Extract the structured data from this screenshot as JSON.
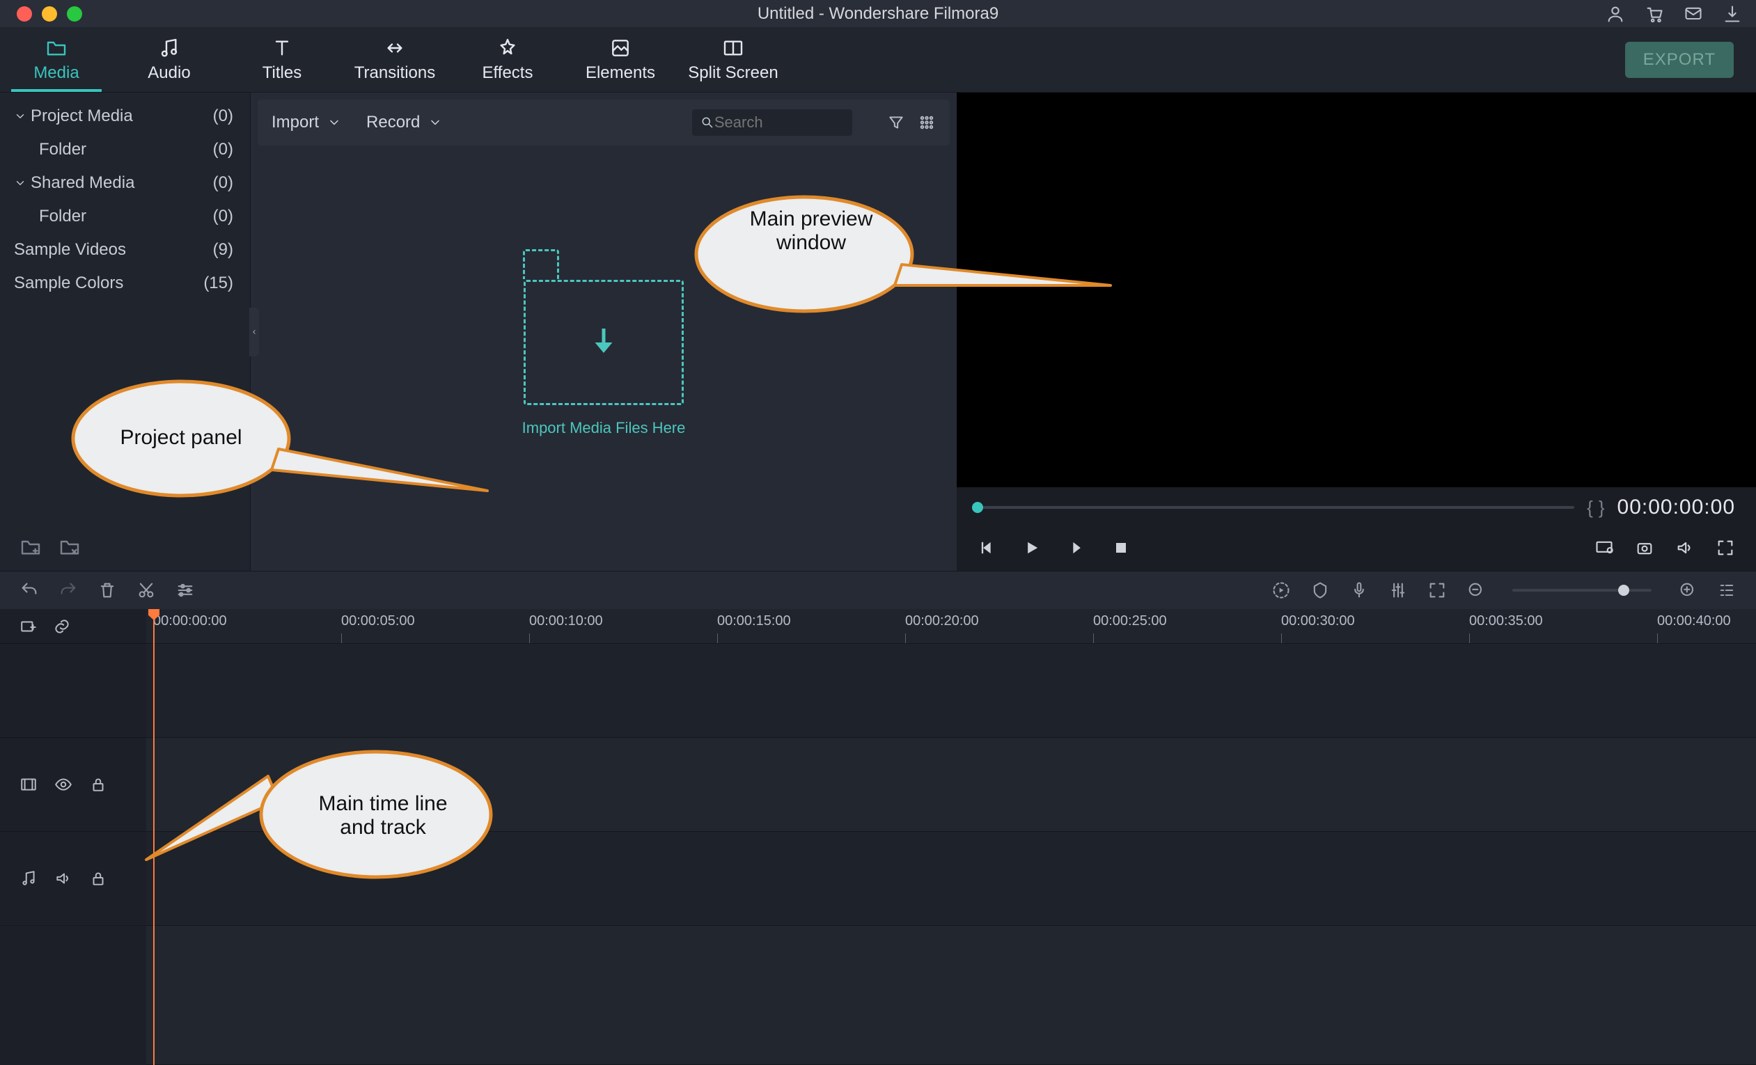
{
  "window": {
    "title": "Untitled - Wondershare Filmora9"
  },
  "tabs": {
    "items": [
      {
        "label": "Media"
      },
      {
        "label": "Audio"
      },
      {
        "label": "Titles"
      },
      {
        "label": "Transitions"
      },
      {
        "label": "Effects"
      },
      {
        "label": "Elements"
      },
      {
        "label": "Split Screen"
      }
    ],
    "active_index": 0,
    "export_label": "EXPORT"
  },
  "sidebar": {
    "items": [
      {
        "label": "Project Media",
        "count": "(0)",
        "expandable": true
      },
      {
        "label": "Folder",
        "count": "(0)",
        "child": true
      },
      {
        "label": "Shared Media",
        "count": "(0)",
        "expandable": true
      },
      {
        "label": "Folder",
        "count": "(0)",
        "child": true
      },
      {
        "label": "Sample Videos",
        "count": "(9)"
      },
      {
        "label": "Sample Colors",
        "count": "(15)"
      }
    ]
  },
  "media_toolbar": {
    "import_label": "Import",
    "record_label": "Record",
    "search_placeholder": "Search"
  },
  "drop": {
    "label": "Import Media Files Here"
  },
  "preview": {
    "timecode": "00:00:00:00"
  },
  "timeline": {
    "ticks": [
      "00:00:00:00",
      "00:00:05:00",
      "00:00:10:00",
      "00:00:15:00",
      "00:00:20:00",
      "00:00:25:00",
      "00:00:30:00",
      "00:00:35:00",
      "00:00:40:00"
    ]
  },
  "callouts": {
    "preview": "Main preview window",
    "project": "Project panel",
    "timeline": "Main time line and track"
  }
}
